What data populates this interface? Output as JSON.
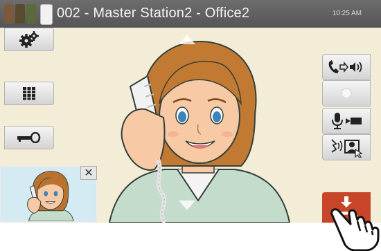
{
  "status_bar": {
    "title": "002 - Master Station2 - Office2",
    "time": "10:25 AM"
  },
  "left_toolbar": [
    {
      "name": "settings-button",
      "icon": "gears-icon"
    },
    {
      "name": "keypad-button",
      "icon": "keypad-icon"
    },
    {
      "name": "door-release-button",
      "icon": "key-icon"
    }
  ],
  "right_toolbar": [
    {
      "name": "transfer-call-button",
      "icon": "handset-to-speaker-icon"
    },
    {
      "name": "record-button",
      "icon": "record-dot-icon"
    },
    {
      "name": "mic-video-button",
      "icon": "mic-and-video-icon"
    },
    {
      "name": "voice-video-toggle-button",
      "icon": "voice-to-video-icon"
    }
  ],
  "pip": {
    "close_icon": "close-icon",
    "close_glyph": "✕"
  },
  "end_call": {
    "icon": "hang-up-icon"
  },
  "colors": {
    "topbar": "#5f5f5f",
    "end_call": "#c8452a",
    "video_bg": "#f3ecd6"
  }
}
